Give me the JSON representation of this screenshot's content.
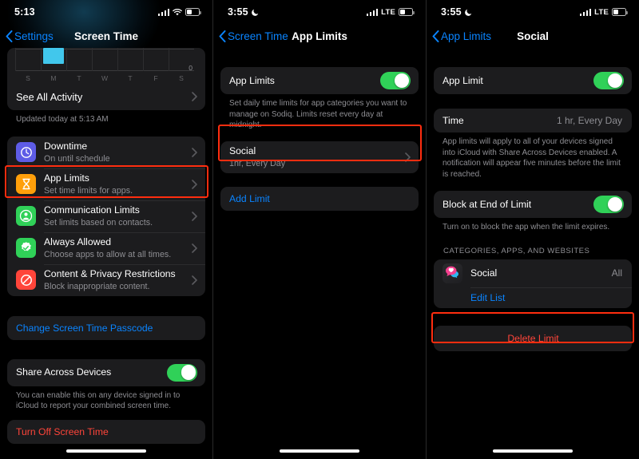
{
  "panels": [
    {
      "name": "screen-time",
      "status": {
        "time": "5:13",
        "moon": false,
        "carrier": "",
        "signal": "signal-bars-icon",
        "wifi": "wifi-icon",
        "battery": "battery-icon"
      },
      "nav": {
        "back": "Settings",
        "title": "Screen Time"
      },
      "chart": {
        "days": [
          "S",
          "M",
          "T",
          "W",
          "T",
          "F",
          "S"
        ],
        "zero_label": "0"
      },
      "see_all": "See All Activity",
      "updated": "Updated today at 5:13 AM",
      "items": [
        {
          "title": "Downtime",
          "sub": "On until schedule",
          "icon": "downtime-icon",
          "color": "#5e5ce6"
        },
        {
          "title": "App Limits",
          "sub": "Set time limits for apps.",
          "icon": "hourglass-icon",
          "color": "#ff9f0a"
        },
        {
          "title": "Communication Limits",
          "sub": "Set limits based on contacts.",
          "icon": "person-icon",
          "color": "#30d158"
        },
        {
          "title": "Always Allowed",
          "sub": "Choose apps to allow at all times.",
          "icon": "checkmark-badge-icon",
          "color": "#30d158"
        },
        {
          "title": "Content & Privacy Restrictions",
          "sub": "Block inappropriate content.",
          "icon": "no-entry-icon",
          "color": "#ff453a"
        }
      ],
      "passcode": "Change Screen Time Passcode",
      "share": {
        "label": "Share Across Devices",
        "on": true
      },
      "share_note": "You can enable this on any device signed in to iCloud to report your combined screen time.",
      "turn_off": "Turn Off Screen Time"
    },
    {
      "name": "app-limits",
      "status": {
        "time": "3:55",
        "moon": true,
        "carrier": "LTE"
      },
      "nav": {
        "back": "Screen Time",
        "title": "App Limits"
      },
      "toggle": {
        "label": "App Limits",
        "on": true
      },
      "note": "Set daily time limits for app categories you want to manage on Sodiq. Limits reset every day at midnight.",
      "limit": {
        "title": "Social",
        "sub": "1hr, Every Day"
      },
      "add": "Add Limit"
    },
    {
      "name": "social-limit",
      "status": {
        "time": "3:55",
        "moon": true,
        "carrier": "LTE"
      },
      "nav": {
        "back": "App Limits",
        "title": "Social"
      },
      "toggle": {
        "label": "App Limit",
        "on": true
      },
      "time": {
        "label": "Time",
        "value": "1 hr, Every Day"
      },
      "note": "App limits will apply to all of your devices signed into iCloud with Share Across Devices enabled. A notification will appear five minutes before the limit is reached.",
      "block": {
        "label": "Block at End of Limit",
        "on": true
      },
      "block_note": "Turn on to block the app when the limit expires.",
      "section_header": "CATEGORIES, APPS, AND WEBSITES",
      "category": {
        "title": "Social",
        "value": "All",
        "icon": "social-bubble-icon"
      },
      "edit": "Edit List",
      "delete": "Delete Limit"
    }
  ],
  "colors": {
    "highlight": "#ff2d0f",
    "accent_blue": "#0a84ff",
    "destructive": "#ff453a",
    "toggle_on": "#30d158",
    "chart_bar": "#41c7ec"
  }
}
